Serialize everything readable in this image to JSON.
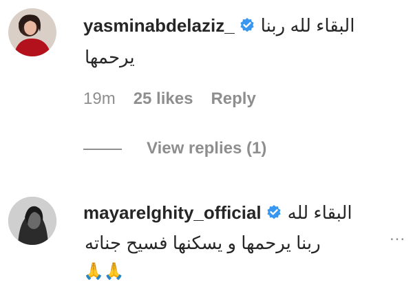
{
  "comments": [
    {
      "username": "yasminabdelaziz_",
      "verified": true,
      "text_line1": "البقاء لله ربنا",
      "text_line2": "يرحمها",
      "time": "19m",
      "likes": "25 likes",
      "reply": "Reply",
      "view_replies": "View replies (1)",
      "avatar_icon": "avatar-red-dress"
    },
    {
      "username": "mayarelghity_official",
      "verified": true,
      "text_line1": "البقاء لله",
      "text_line2": "ربنا يرحمها و يسكنها فسيح جناته",
      "emoji": "🙏🙏",
      "more": "...",
      "avatar_icon": "avatar-bw-portrait"
    }
  ],
  "colors": {
    "primary_text": "#262626",
    "secondary_text": "#8e8e8e",
    "verified_blue": "#3897f0"
  }
}
